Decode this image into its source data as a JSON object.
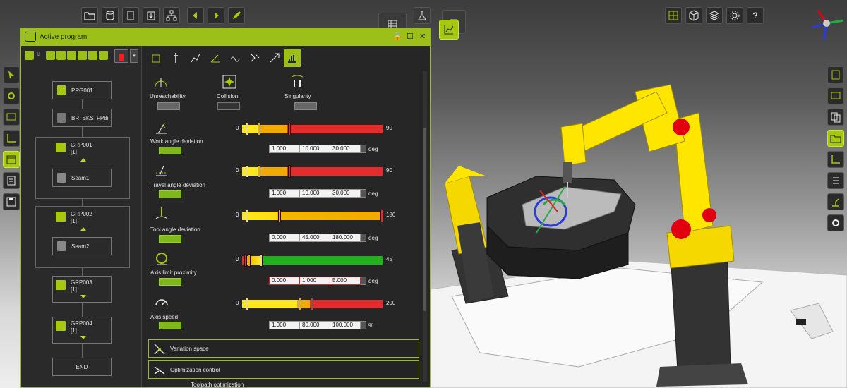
{
  "top_toolbar": {
    "buttons": [
      "open-folder-icon",
      "database-icon",
      "document-icon",
      "import-icon",
      "hierarchy-icon",
      "arrow-left-icon",
      "arrow-right-icon",
      "pencil-icon"
    ]
  },
  "view_toolbar": {
    "buttons": [
      "layout-grid-icon",
      "cube-icon",
      "layers-icon",
      "gear-icon"
    ],
    "help_label": "?"
  },
  "window": {
    "title": "Active program",
    "program_tree": {
      "program": "PRG001",
      "tool": "BR_SKS_FP8i_...",
      "groups": [
        {
          "name": "GRP001",
          "count": "[1]",
          "seam": "Seam1"
        },
        {
          "name": "GRP002",
          "count": "[1]",
          "seam": "Seam2"
        },
        {
          "name": "GRP003",
          "count": "[1]"
        },
        {
          "name": "GRP004",
          "count": "[1]"
        }
      ],
      "end": "END"
    },
    "indicators": {
      "unreachability": "Unreachability",
      "collision": "Collision",
      "singularity": "Singularity"
    },
    "parameters": [
      {
        "label": "Work angle deviation",
        "min": "0",
        "max": "90",
        "values": [
          "1.000",
          "10.000",
          "30.000"
        ],
        "unit": "deg",
        "red_boxes": false
      },
      {
        "label": "Travel angle deviation",
        "min": "0",
        "max": "90",
        "values": [
          "1.000",
          "10.000",
          "30.000"
        ],
        "unit": "deg",
        "red_boxes": false
      },
      {
        "label": "Tool angle deviation",
        "min": "0",
        "max": "180",
        "values": [
          "0.000",
          "45.000",
          "180.000"
        ],
        "unit": "deg",
        "red_boxes": false
      },
      {
        "label": "Axis limit proximity",
        "min": "0",
        "max": "45",
        "values": [
          "0.000",
          "1.000",
          "5.000"
        ],
        "unit": "deg",
        "red_boxes": true
      },
      {
        "label": "Axis speed",
        "min": "0",
        "max": "200",
        "values": [
          "1.000",
          "80.000",
          "100.000"
        ],
        "unit": "%",
        "red_boxes": false
      }
    ],
    "sections": {
      "variation_space": "Variation space",
      "optimization_control": "Optimization control",
      "toolpath_optimization": "Toolpath optimization"
    }
  },
  "colors": {
    "accent": "#9dbf1a",
    "yellow": "#ffe81a",
    "orange": "#f2a900",
    "red": "#e52c2c",
    "green": "#22b21e"
  }
}
